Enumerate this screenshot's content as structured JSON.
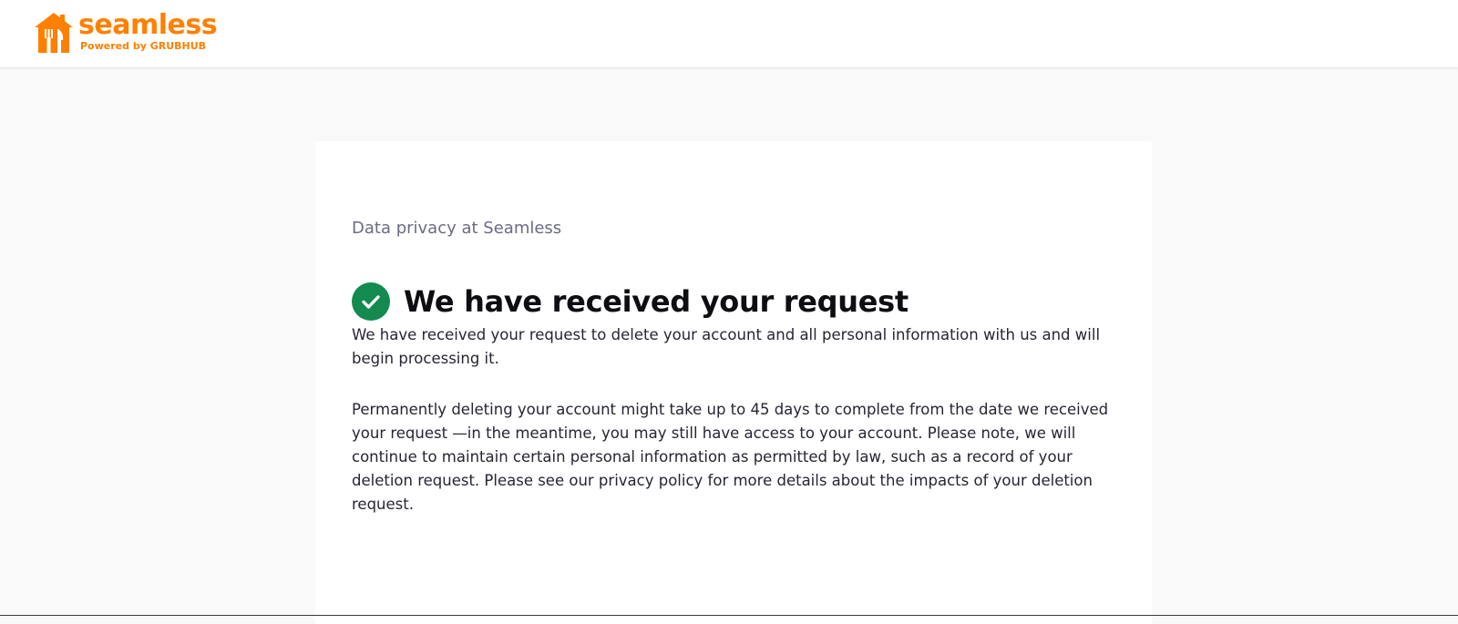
{
  "brand": {
    "name": "seamless",
    "tagline": "Powered by GRUBHUB",
    "color": "#ff8000"
  },
  "page": {
    "eyebrow": "Data privacy at Seamless",
    "title": "We have received your request",
    "title_icon": "check-circle-icon",
    "success_color": "#138a4e",
    "paragraph_1": "We have received your request to delete your account and all personal information with us and will begin processing it.",
    "paragraph_2": "Permanently deleting your account might take up to 45 days to complete from the date we received your request —in the meantime, you may still have access to your account. Please note, we will continue to maintain certain personal information as permitted by law, such as a record of your deletion request. Please see our privacy policy for more details about the impacts of your deletion request."
  }
}
